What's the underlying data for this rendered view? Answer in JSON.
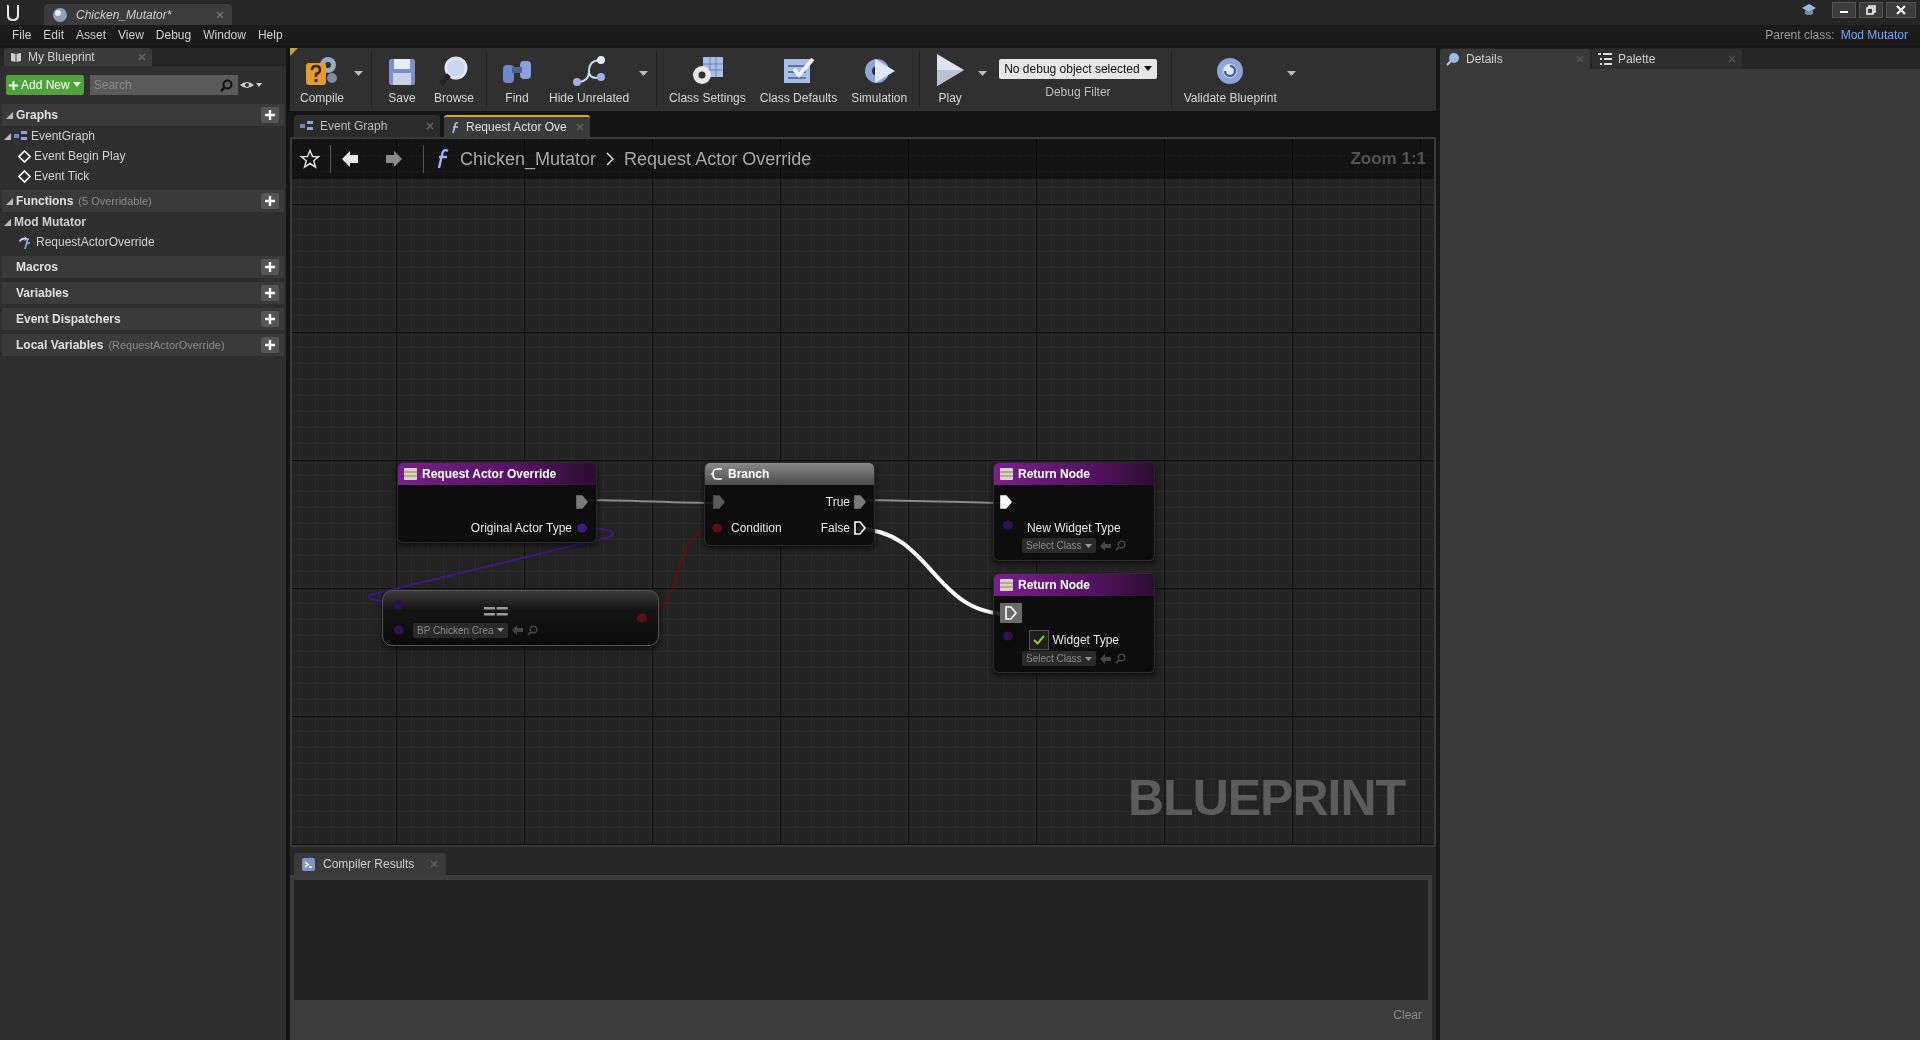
{
  "window": {
    "tab_title": "Chicken_Mutator*",
    "parent_class_label": "Parent class:",
    "parent_class": "Mod Mutator"
  },
  "menu": [
    "File",
    "Edit",
    "Asset",
    "View",
    "Debug",
    "Window",
    "Help"
  ],
  "my_blueprint": {
    "tab": "My Blueprint",
    "add_new": "Add New",
    "search": {
      "placeholder": "Search"
    },
    "sections": [
      {
        "label": "Graphs",
        "expanded": true,
        "children": [
          {
            "label": "EventGraph",
            "kind": "graph",
            "expanded": true,
            "children": [
              {
                "label": "Event Begin Play",
                "kind": "event"
              },
              {
                "label": "Event Tick",
                "kind": "event"
              }
            ]
          }
        ]
      },
      {
        "label": "Functions",
        "note": "(5 Overridable)",
        "expanded": true,
        "children": [
          {
            "label": "Mod Mutator",
            "kind": "category",
            "expanded": true,
            "children": [
              {
                "label": "RequestActorOverride",
                "kind": "function"
              }
            ]
          }
        ]
      },
      {
        "label": "Macros",
        "expanded": false
      },
      {
        "label": "Variables",
        "expanded": false
      },
      {
        "label": "Event Dispatchers",
        "expanded": false
      },
      {
        "label": "Local Variables",
        "note": "(RequestActorOverride)",
        "expanded": false
      }
    ]
  },
  "toolbar": [
    [
      {
        "kind": "button",
        "label": "Compile",
        "dropdown": true
      }
    ],
    [
      {
        "kind": "button",
        "label": "Save",
        "dropdown": false
      },
      {
        "kind": "button",
        "label": "Browse",
        "dropdown": false
      }
    ],
    [
      {
        "kind": "button",
        "label": "Find",
        "dropdown": false
      },
      {
        "kind": "button",
        "label": "Hide Unrelated",
        "dropdown": true
      }
    ],
    [
      {
        "kind": "button",
        "label": "Class Settings",
        "dropdown": false
      },
      {
        "kind": "button",
        "label": "Class Defaults",
        "dropdown": false
      },
      {
        "kind": "button",
        "label": "Simulation",
        "dropdown": false
      }
    ],
    [
      {
        "kind": "button",
        "label": "Play",
        "dropdown": true
      },
      {
        "kind": "debug_filter",
        "value": "No debug object selected",
        "label": "Debug Filter"
      }
    ],
    [
      {
        "kind": "button",
        "label": "Validate Blueprint",
        "dropdown": true
      }
    ]
  ],
  "doc_tabs": [
    {
      "label": "Event Graph",
      "kind": "graph",
      "selected": false
    },
    {
      "label": "Request Actor Ove",
      "kind": "function",
      "selected": true
    }
  ],
  "breadcrumb": {
    "path": [
      "Chicken_Mutator",
      "Request Actor Override"
    ],
    "zoom": "Zoom 1:1"
  },
  "nodes": [
    {
      "kind": "entry",
      "title": "Request Actor Override",
      "output_label": "Original Actor Type"
    },
    {
      "kind": "branch",
      "title": "Branch",
      "condition_label": "Condition",
      "true_label": "True",
      "false_label": "False"
    },
    {
      "kind": "return",
      "title": "Return Node",
      "value_label": "New Widget Type",
      "class_picker": "Select Class",
      "checked": false
    },
    {
      "kind": "compare",
      "symbol": "==",
      "class_picker": "BP Chicken Crea"
    },
    {
      "kind": "return",
      "title": "Return Node",
      "value_label": "Widget Type",
      "class_picker": "Select Class",
      "checked": true
    }
  ],
  "wires": [
    {
      "kind": "exec",
      "highlighted": false
    },
    {
      "kind": "exec",
      "highlighted": false
    },
    {
      "kind": "exec",
      "highlighted": true
    },
    {
      "kind": "class",
      "highlighted": false
    },
    {
      "kind": "bool",
      "highlighted": false
    }
  ],
  "watermark": "BLUEPRINT",
  "compiler": {
    "tab": "Compiler Results",
    "clear": "Clear"
  },
  "right_tabs": [
    {
      "label": "Details",
      "selected": true
    },
    {
      "label": "Palette",
      "selected": false
    }
  ]
}
